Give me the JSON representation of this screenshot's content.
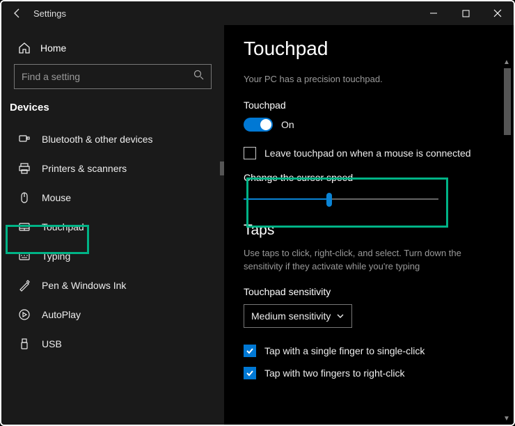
{
  "titlebar": {
    "app_name": "Settings"
  },
  "sidebar": {
    "home_label": "Home",
    "search_placeholder": "Find a setting",
    "category": "Devices",
    "items": [
      {
        "icon": "bluetooth-icon",
        "label": "Bluetooth & other devices"
      },
      {
        "icon": "printer-icon",
        "label": "Printers & scanners"
      },
      {
        "icon": "mouse-icon",
        "label": "Mouse"
      },
      {
        "icon": "touchpad-icon",
        "label": "Touchpad",
        "selected": true
      },
      {
        "icon": "typing-icon",
        "label": "Typing"
      },
      {
        "icon": "pen-icon",
        "label": "Pen & Windows Ink"
      },
      {
        "icon": "autoplay-icon",
        "label": "AutoPlay"
      },
      {
        "icon": "usb-icon",
        "label": "USB"
      }
    ]
  },
  "content": {
    "title": "Touchpad",
    "precision_text": "Your PC has a precision touchpad.",
    "touchpad_section": {
      "label": "Touchpad",
      "toggle_state": "On",
      "leave_on_label": "Leave touchpad on when a mouse is connected"
    },
    "cursor_speed": {
      "label": "Change the cursor speed",
      "value_percent": 44
    },
    "taps": {
      "heading": "Taps",
      "description": "Use taps to click, right-click, and select. Turn down the sensitivity if they activate while you're typing",
      "sensitivity_label": "Touchpad sensitivity",
      "sensitivity_value": "Medium sensitivity",
      "options": [
        {
          "label": "Tap with a single finger to single-click",
          "checked": true
        },
        {
          "label": "Tap with two fingers to right-click",
          "checked": true
        }
      ]
    }
  },
  "colors": {
    "accent": "#0078d4",
    "highlight": "#00b386"
  }
}
